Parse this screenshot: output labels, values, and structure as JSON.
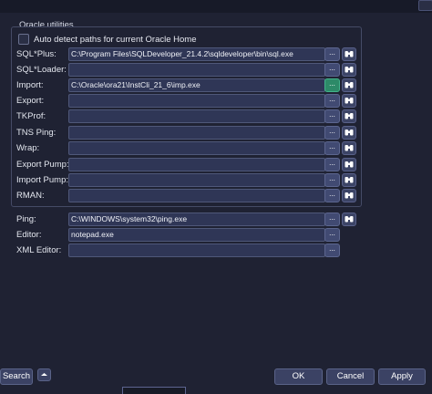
{
  "group_title": "Oracle utilities",
  "auto_detect_label": "Auto detect paths for current Oracle Home",
  "rows": [
    {
      "label": "SQL*Plus:",
      "value": "C:\\Program Files\\SQLDeveloper_21.4.2\\sqldeveloper\\bin\\sql.exe",
      "has_binoculars": true
    },
    {
      "label": "SQL*Loader:",
      "value": "",
      "has_binoculars": true
    },
    {
      "label": "Import:",
      "value": "C:\\Oracle\\ora21\\InstCli_21_6\\imp.exe",
      "has_binoculars": true,
      "active": true
    },
    {
      "label": "Export:",
      "value": "",
      "has_binoculars": true
    },
    {
      "label": "TKProf:",
      "value": "",
      "has_binoculars": true
    },
    {
      "label": "TNS Ping:",
      "value": "",
      "has_binoculars": true
    },
    {
      "label": "Wrap:",
      "value": "",
      "has_binoculars": true
    },
    {
      "label": "Export Pump:",
      "value": "",
      "has_binoculars": true
    },
    {
      "label": "Import Pump:",
      "value": "",
      "has_binoculars": true
    },
    {
      "label": "RMAN:",
      "value": "",
      "has_binoculars": true
    },
    {
      "label": "Ping:",
      "value": "C:\\WINDOWS\\system32\\ping.exe",
      "has_binoculars": true
    },
    {
      "label": "Editor:",
      "value": "notepad.exe",
      "has_binoculars": false
    },
    {
      "label": "XML Editor:",
      "value": "",
      "has_binoculars": false
    }
  ],
  "buttons": {
    "search": "Search",
    "ok": "OK",
    "cancel": "Cancel",
    "apply": "Apply",
    "browse": "..."
  },
  "icons": {
    "browse": "ellipsis-icon",
    "find": "binoculars-icon",
    "collapse": "up-arrow-icon"
  }
}
